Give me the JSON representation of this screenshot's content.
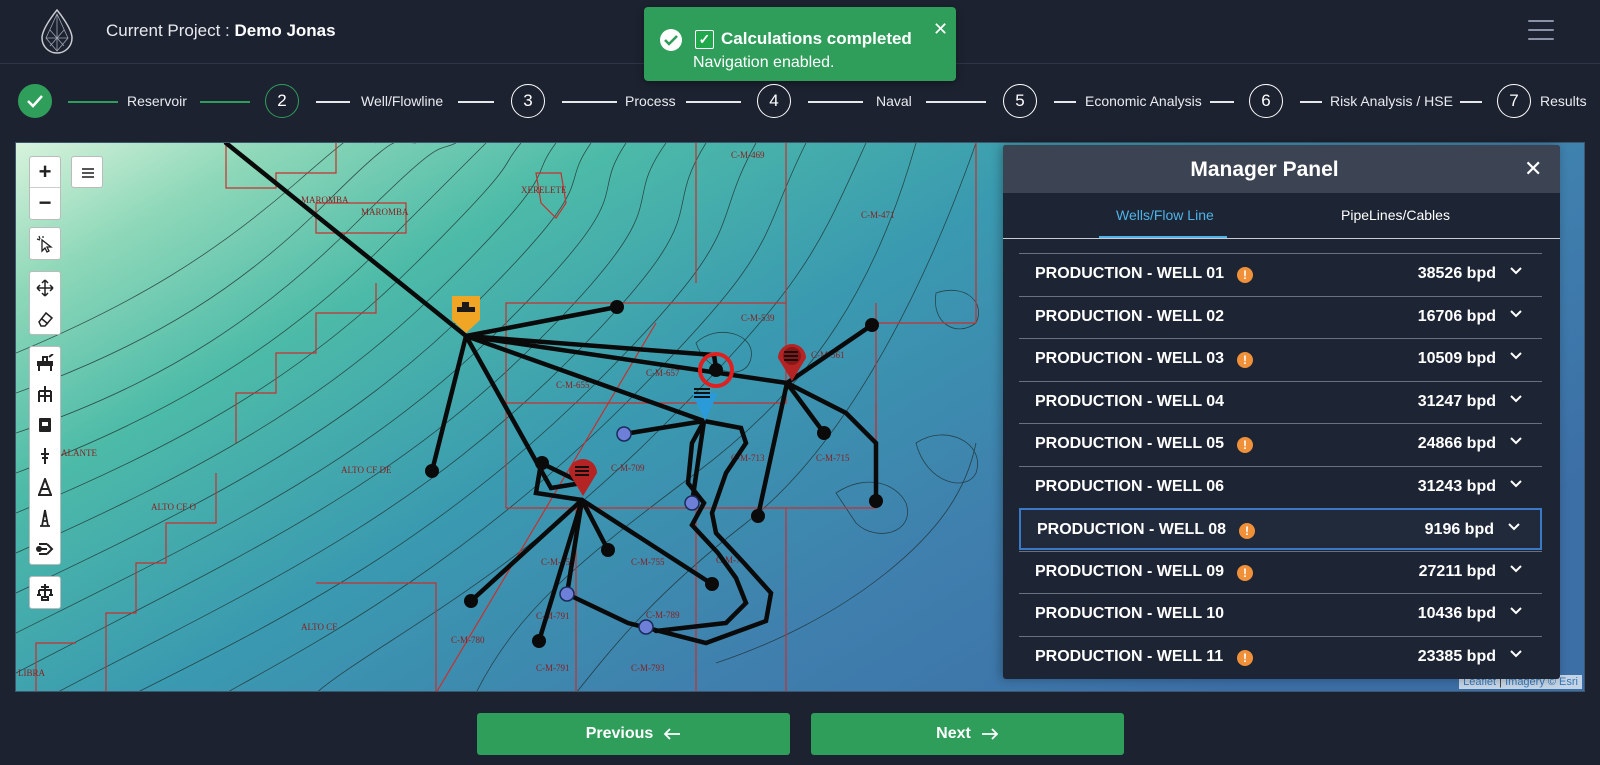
{
  "header": {
    "project_label": "Current Project :",
    "project_name": "Demo Jonas",
    "logo_icon": "drop-logo-icon",
    "menu_icon": "hamburger-menu-icon"
  },
  "toast": {
    "title": "Calculations completed",
    "message": "Navigation enabled.",
    "color": "#2f9e5b"
  },
  "stepper": {
    "steps": [
      {
        "number": "",
        "label": "Reservoir",
        "state": "done"
      },
      {
        "number": "2",
        "label": "Well/Flowline",
        "state": "active"
      },
      {
        "number": "3",
        "label": "Process",
        "state": "pending"
      },
      {
        "number": "4",
        "label": "Naval",
        "state": "pending"
      },
      {
        "number": "5",
        "label": "Economic Analysis",
        "state": "pending"
      },
      {
        "number": "6",
        "label": "Risk Analysis / HSE",
        "state": "pending"
      },
      {
        "number": "7",
        "label": "Results",
        "state": "pending"
      }
    ]
  },
  "map": {
    "zoom_in": "+",
    "zoom_out": "−",
    "attribution_leaflet": "Leaflet",
    "attribution_sep": "|",
    "attribution_imagery": "Imagery © Esri",
    "block_labels": [
      "MAROMBA",
      "XERELETE",
      "C-M-469",
      "C-M-471",
      "ALTO CF",
      "ALTO CF DE",
      "ALTO CF O",
      "C-M-657",
      "C-M-709",
      "C-M-711",
      "C-M-713",
      "C-M-715",
      "C-M-753",
      "C-M-780",
      "C-M-791",
      "C-M-793",
      "LIBRA"
    ]
  },
  "panel": {
    "title": "Manager Panel",
    "tabs": [
      "Wells/Flow Line",
      "PipeLines/Cables"
    ],
    "active_tab": "Wells/Flow Line",
    "wells": [
      {
        "name": "PRODUCTION - WELL 01",
        "value": "38526 bpd",
        "warning": true
      },
      {
        "name": "PRODUCTION - WELL 02",
        "value": "16706 bpd",
        "warning": false
      },
      {
        "name": "PRODUCTION - WELL 03",
        "value": "10509 bpd",
        "warning": true
      },
      {
        "name": "PRODUCTION - WELL 04",
        "value": "31247 bpd",
        "warning": false
      },
      {
        "name": "PRODUCTION - WELL 05",
        "value": "24866 bpd",
        "warning": true
      },
      {
        "name": "PRODUCTION - WELL 06",
        "value": "31243 bpd",
        "warning": false
      },
      {
        "name": "PRODUCTION - WELL 08",
        "value": "9196 bpd",
        "warning": true,
        "selected": true
      },
      {
        "name": "PRODUCTION - WELL 09",
        "value": "27211 bpd",
        "warning": true
      },
      {
        "name": "PRODUCTION - WELL 10",
        "value": "10436 bpd",
        "warning": false
      },
      {
        "name": "PRODUCTION - WELL 11",
        "value": "23385 bpd",
        "warning": true
      }
    ]
  },
  "footer": {
    "previous": "Previous",
    "next": "Next"
  }
}
